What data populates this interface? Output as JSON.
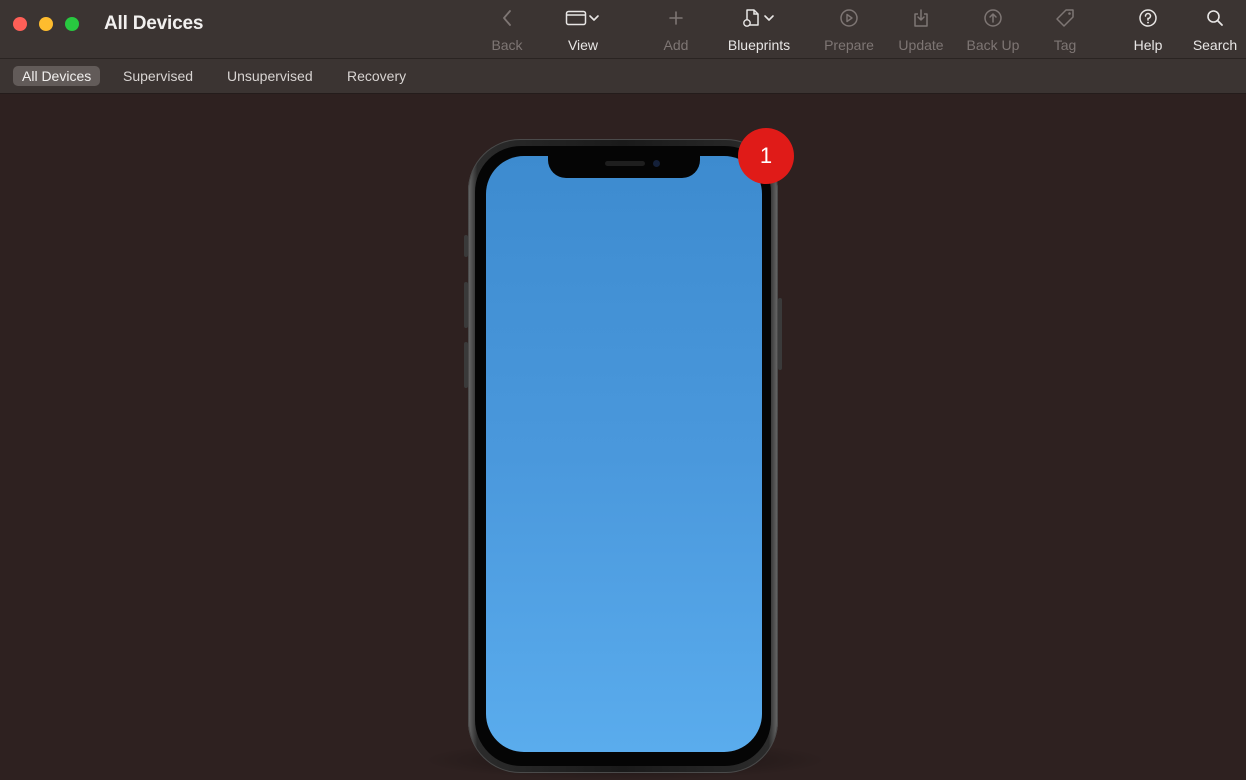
{
  "window": {
    "title": "All Devices"
  },
  "toolbar": {
    "items": [
      {
        "label": "Back",
        "icon": "chevron-left-icon",
        "enabled": false
      },
      {
        "label": "View",
        "icon": "window-icon",
        "enabled": true
      },
      {
        "label": "Add",
        "icon": "plus-icon",
        "enabled": false
      },
      {
        "label": "Blueprints",
        "icon": "blueprint-document-icon",
        "enabled": true
      },
      {
        "label": "Prepare",
        "icon": "prepare-icon",
        "enabled": false
      },
      {
        "label": "Update",
        "icon": "update-icon",
        "enabled": false
      },
      {
        "label": "Back Up",
        "icon": "backup-icon",
        "enabled": false
      },
      {
        "label": "Tag",
        "icon": "tag-icon",
        "enabled": false
      },
      {
        "label": "Help",
        "icon": "question-circle-icon",
        "enabled": true
      },
      {
        "label": "Search",
        "icon": "magnifier-icon",
        "enabled": true
      }
    ]
  },
  "tabs": [
    {
      "label": "All Devices",
      "active": true
    },
    {
      "label": "Supervised",
      "active": false
    },
    {
      "label": "Unsupervised",
      "active": false
    },
    {
      "label": "Recovery",
      "active": false
    }
  ],
  "device": {
    "badge_count": "1"
  },
  "colors": {
    "background": "#2e2120",
    "toolbar": "#3b3432",
    "badge": "#e01b18",
    "screen_top": "#3d8bcf",
    "screen_bottom": "#5aaced"
  }
}
